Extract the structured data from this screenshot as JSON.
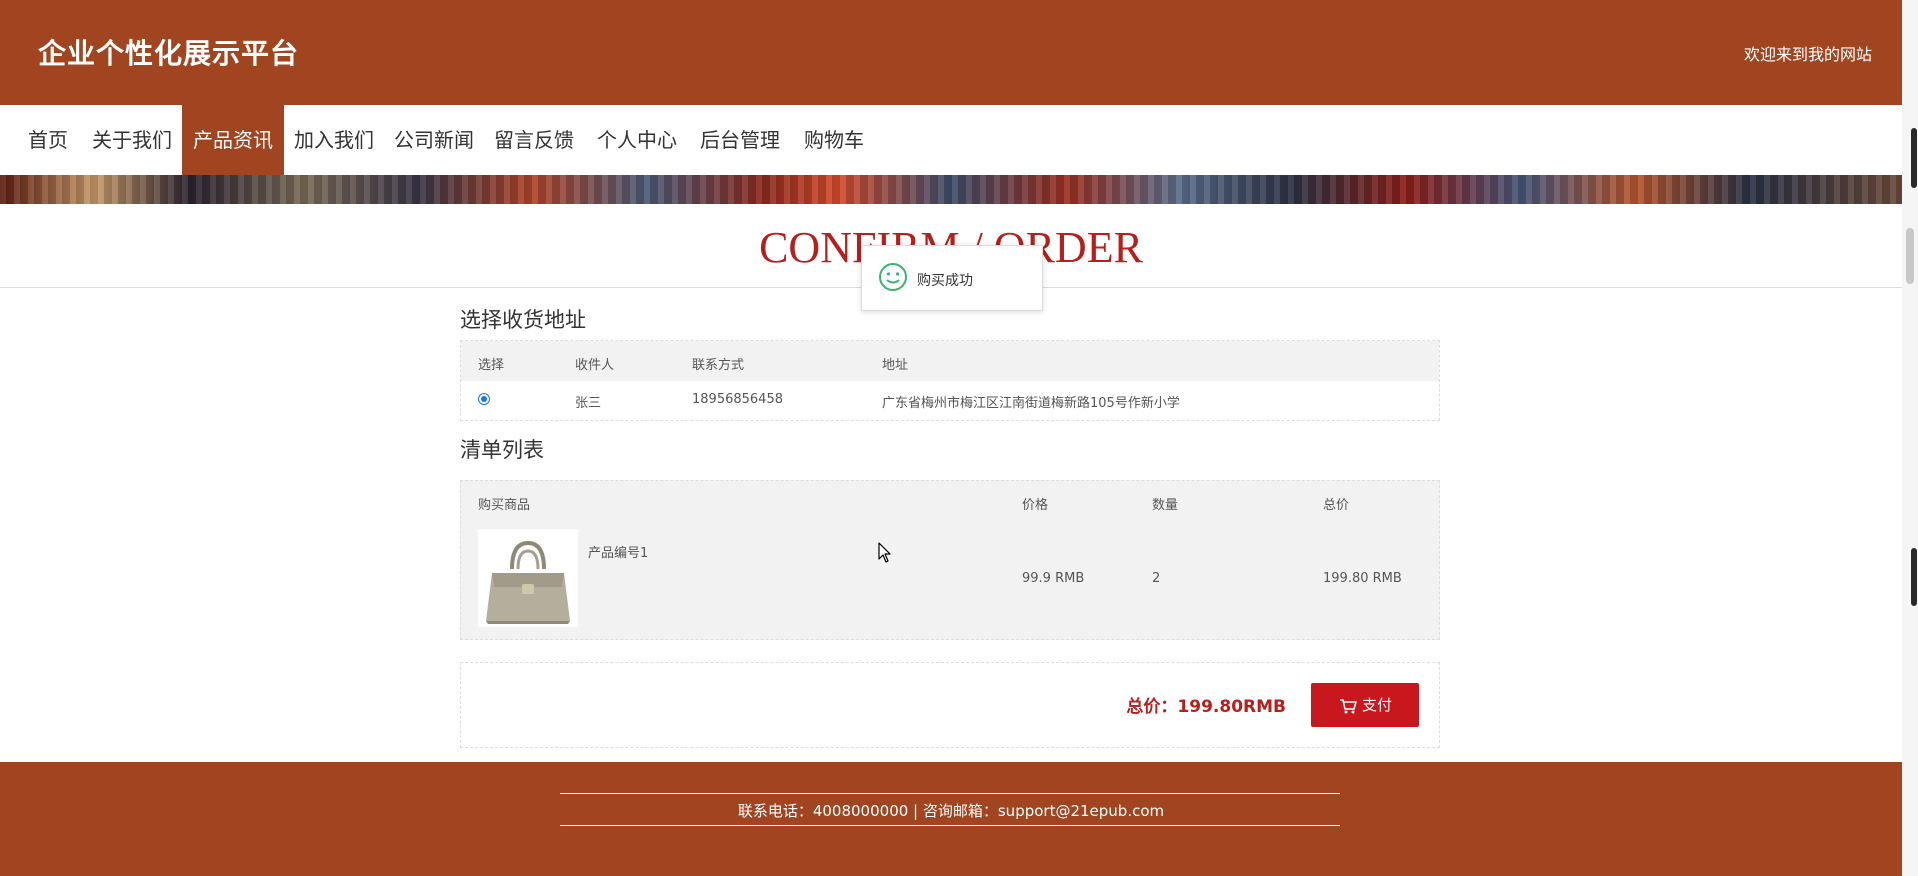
{
  "header": {
    "site_title": "企业个性化展示平台",
    "welcome": "欢迎来到我的网站"
  },
  "nav": [
    {
      "label": "首页",
      "active": false
    },
    {
      "label": "关于我们",
      "active": false
    },
    {
      "label": "产品资讯",
      "active": true
    },
    {
      "label": "加入我们",
      "active": false
    },
    {
      "label": "公司新闻",
      "active": false
    },
    {
      "label": "留言反馈",
      "active": false
    },
    {
      "label": "个人中心",
      "active": false
    },
    {
      "label": "后台管理",
      "active": false
    },
    {
      "label": "购物车",
      "active": false
    }
  ],
  "page_heading": "CONFIRM / ORDER",
  "toast": {
    "message": "购买成功",
    "icon": "smile-icon"
  },
  "address_section": {
    "title": "选择收货地址",
    "columns": [
      "选择",
      "收件人",
      "联系方式",
      "地址"
    ],
    "rows": [
      {
        "selected": true,
        "recipient": "张三",
        "phone": "18956856458",
        "address": "广东省梅州市梅江区江南街道梅新路105号作新小学"
      }
    ]
  },
  "list_section": {
    "title": "清单列表",
    "columns": [
      "购买商品",
      "价格",
      "数量",
      "总价"
    ],
    "items": [
      {
        "name": "产品编号1",
        "price": "99.9 RMB",
        "quantity": "2",
        "subtotal": "199.80 RMB",
        "image": "handbag-image"
      }
    ]
  },
  "checkout": {
    "total_label": "总价：199.80RMB",
    "pay_label": "支付"
  },
  "footer": {
    "contact": "联系电话：4008000000 | 咨询邮箱：support@21epub.com"
  },
  "colors": {
    "brand": "#a0451f",
    "accent_red": "#c9171e",
    "heading_red": "#b6201c"
  }
}
